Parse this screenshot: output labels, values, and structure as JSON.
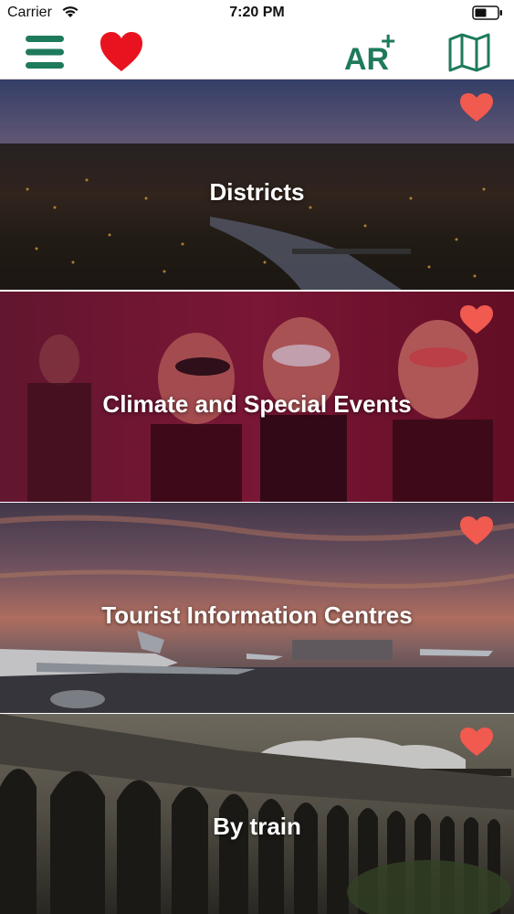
{
  "status_bar": {
    "carrier": "Carrier",
    "time": "7:20 PM"
  },
  "nav": {
    "ar_label": "AR",
    "ar_plus": "+",
    "accent_color": "#1e7a5c",
    "favorite_color": "#e8131f"
  },
  "categories": [
    {
      "title": "Districts",
      "icons": [
        "heart-icon"
      ]
    },
    {
      "title": "Climate and Special Events",
      "icons": [
        "heart-icon"
      ]
    },
    {
      "title": "Tourist Information Centres",
      "icons": [
        "heart-icon"
      ]
    },
    {
      "title": "By train",
      "icons": [
        "heart-icon"
      ]
    }
  ],
  "card_heart_color": "#f05a4f"
}
